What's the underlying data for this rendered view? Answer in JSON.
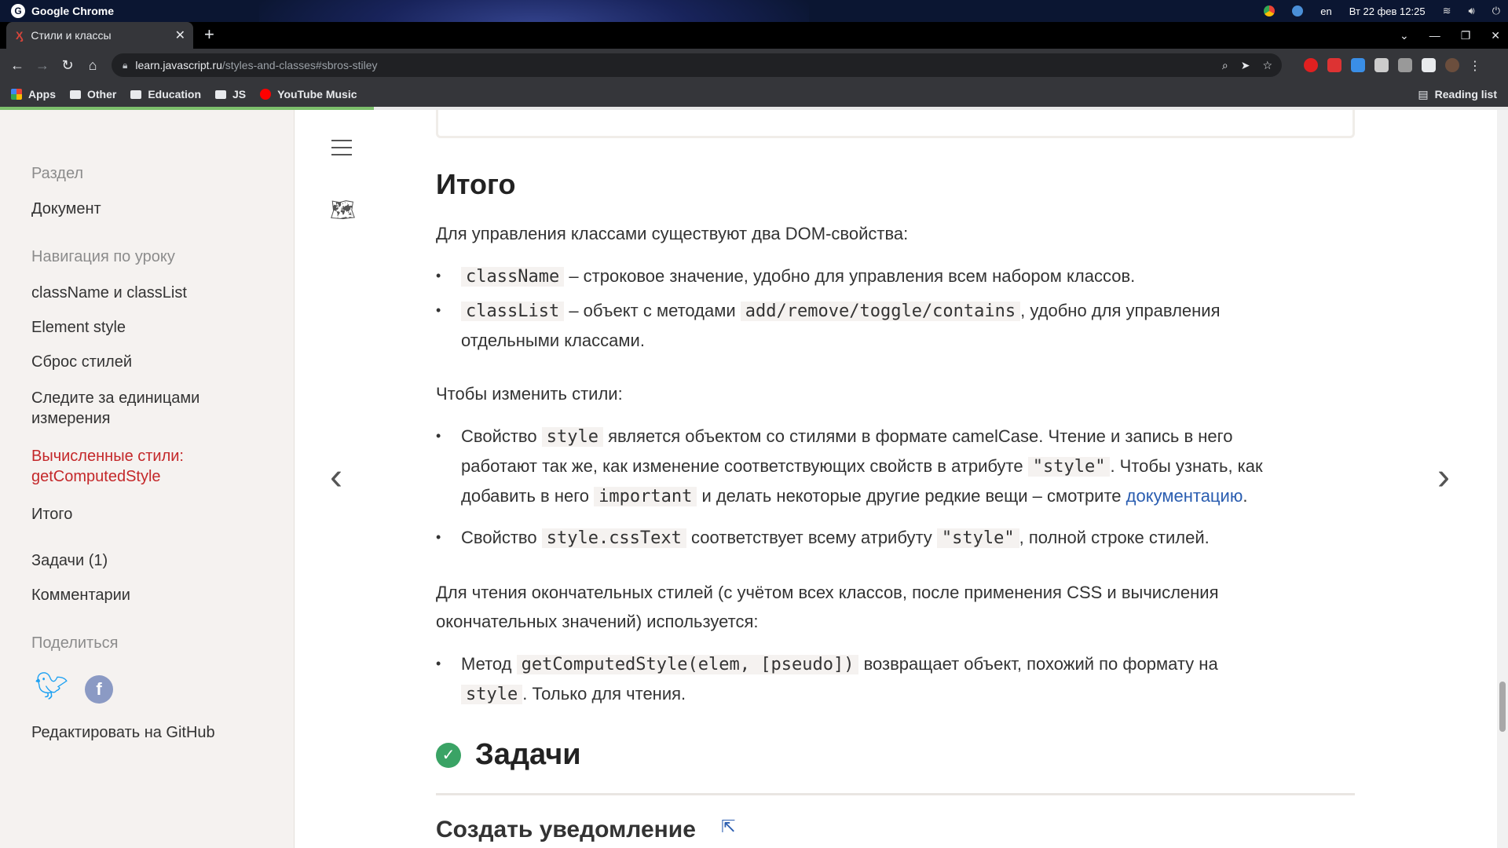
{
  "os": {
    "app_name": "Google Chrome",
    "lang": "en",
    "datetime": "Вт 22 фев  12:25"
  },
  "browser": {
    "tab_title": "Стили и классы",
    "url_host": "learn.javascript.ru",
    "url_path": "/styles-and-classes#sbros-stiley",
    "bookmarks": [
      "Apps",
      "Other",
      "Education",
      "JS",
      "YouTube Music"
    ],
    "reading_list": "Reading list"
  },
  "sidebar": {
    "section_label": "Раздел",
    "section_item": "Документ",
    "nav_label": "Навигация по уроку",
    "nav_items": [
      "className и classList",
      "Element style",
      "Сброс стилей",
      "Следите за единицами",
      "измерения",
      "Вычисленные стили:",
      "getComputedStyle",
      "Итого"
    ],
    "tasks": "Задачи (1)",
    "comments": "Комментарии",
    "share_label": "Поделиться",
    "edit_github": "Редактировать на GitHub"
  },
  "content": {
    "heading": "Итого",
    "p1": "Для управления классами существуют два DOM-свойства:",
    "li1_code": "className",
    "li1_text": " – строковое значение, удобно для управления всем набором классов.",
    "li2_code": "classList",
    "li2_text_a": " – объект с методами ",
    "li2_code2": "add/remove/toggle/contains",
    "li2_text_b": ", удобно для управления",
    "li2_text_c": "отдельными классами.",
    "p2": "Чтобы изменить стили:",
    "li3_a": "Свойство ",
    "li3_code1": "style",
    "li3_b": " является объектом со стилями в формате camelCase. Чтение и запись в него",
    "li3_c": "работают так же, как изменение соответствующих свойств в атрибуте ",
    "li3_code2": "\"style\"",
    "li3_d": ". Чтобы узнать, как",
    "li3_e": "добавить в него ",
    "li3_code3": "important",
    "li3_f": " и делать некоторые другие редкие вещи – смотрите ",
    "li3_link": "документацию",
    "li3_g": ".",
    "li4_a": "Свойство ",
    "li4_code1": "style.cssText",
    "li4_b": " соответствует всему атрибуту ",
    "li4_code2": "\"style\"",
    "li4_c": ", полной строке стилей.",
    "p3_a": "Для чтения окончательных стилей (с учётом всех классов, после применения CSS и вычисления",
    "p3_b": "окончательных значений) используется:",
    "li5_a": "Метод ",
    "li5_code1": "getComputedStyle(elem, [pseudo])",
    "li5_b": " возвращает объект, похожий по формату на",
    "li5_code2": "style",
    "li5_c": ". Только для чтения.",
    "tasks_heading": "Задачи",
    "task_title": "Создать уведомление"
  }
}
